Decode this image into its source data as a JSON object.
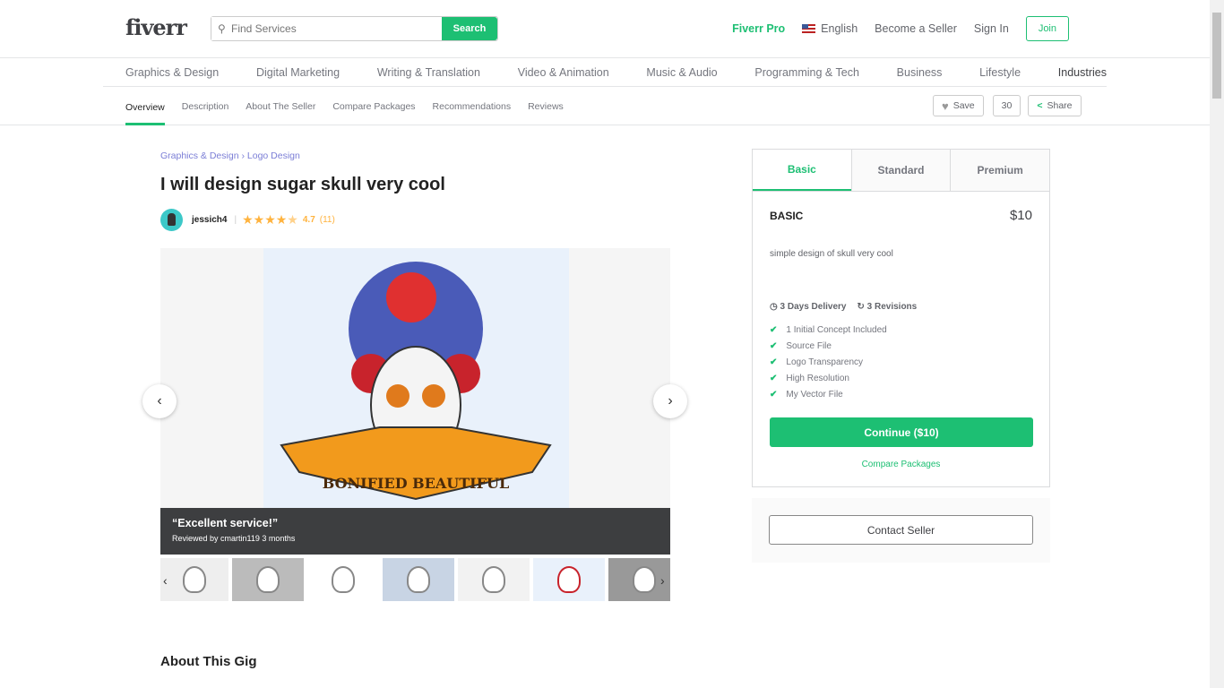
{
  "header": {
    "logo": "fiverr",
    "search_placeholder": "Find Services",
    "search_button": "Search",
    "fiverr_pro": "Fiverr Pro",
    "language": "English",
    "become_seller": "Become a Seller",
    "sign_in": "Sign In",
    "join": "Join"
  },
  "categories": [
    "Graphics & Design",
    "Digital Marketing",
    "Writing & Translation",
    "Video & Animation",
    "Music & Audio",
    "Programming & Tech",
    "Business",
    "Lifestyle",
    "Industries"
  ],
  "subnav": {
    "tabs": [
      "Overview",
      "Description",
      "About The Seller",
      "Compare Packages",
      "Recommendations",
      "Reviews"
    ],
    "save": "Save",
    "save_count": "30",
    "share": "Share"
  },
  "gig": {
    "breadcrumb": [
      "Graphics & Design",
      "Logo Design"
    ],
    "title": "I will design sugar skull very cool",
    "seller": "jessich4",
    "rating": "4.7",
    "rating_value": 4.7,
    "reviews": "(11)",
    "review_quote": "“Excellent service!”",
    "review_by": "Reviewed by cmartin119 3 months",
    "image_banner": "BONIFIED BEAUTIFUL",
    "about_title": "About This Gig"
  },
  "package": {
    "tabs": [
      "Basic",
      "Standard",
      "Premium"
    ],
    "name": "BASIC",
    "price": "$10",
    "description": "simple design of skull very cool",
    "delivery": "3 Days Delivery",
    "revisions": "3 Revisions",
    "features": [
      "1 Initial Concept Included",
      "Source File",
      "Logo Transparency",
      "High Resolution",
      "My Vector File"
    ],
    "continue": "Continue ($10)",
    "compare": "Compare Packages",
    "contact": "Contact Seller"
  },
  "colors": {
    "accent": "#1dbf73",
    "star": "#ffb33e",
    "breadcrumb": "#7b7ed6"
  }
}
